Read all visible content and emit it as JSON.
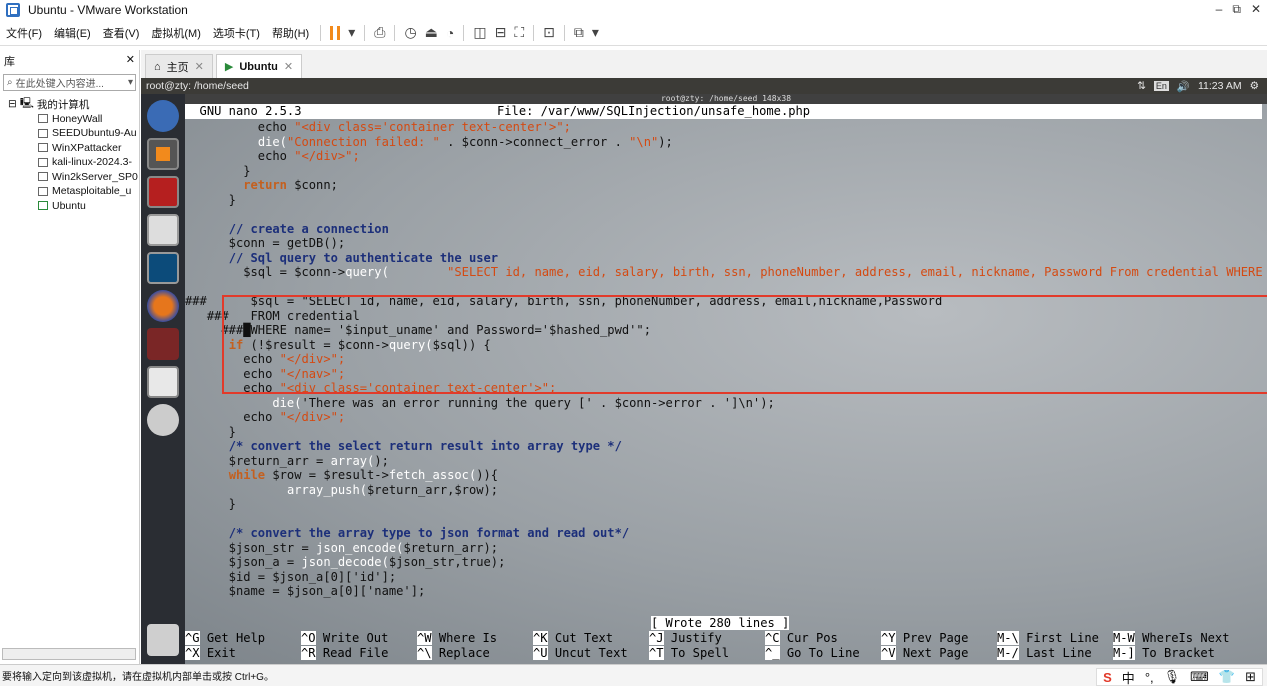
{
  "window": {
    "title": "Ubuntu - VMware Workstation",
    "controls": [
      "–",
      "⧉",
      "✕"
    ]
  },
  "menu": [
    "文件(F)",
    "编辑(E)",
    "查看(V)",
    "虚拟机(M)",
    "选项卡(T)",
    "帮助(H)"
  ],
  "library": {
    "title": "库",
    "close": "✕",
    "search_placeholder": "在此处键入内容进...",
    "root": "我的计算机",
    "vms": [
      "HoneyWall",
      "SEEDUbuntu9-Au",
      "WinXPattacker",
      "kali-linux-2024.3-",
      "Win2kServer_SP0",
      "Metasploitable_u",
      "Ubuntu"
    ]
  },
  "tabs": [
    {
      "label": "主页"
    },
    {
      "label": "Ubuntu"
    }
  ],
  "ubuntu": {
    "topbar_title": "root@zty: /home/seed",
    "clock": "11:23 AM",
    "lang": "En",
    "term_title": "root@zty: /home/seed 148x38"
  },
  "nano": {
    "version": "  GNU nano 2.5.3",
    "file": "File: /var/www/SQLInjection/unsafe_home.php",
    "status": "[ Wrote 280 lines ]"
  },
  "code": [
    [
      {
        "t": "          echo ",
        "c": "vr"
      },
      {
        "t": "\"<div class='container text-center'>\";",
        "c": "st"
      }
    ],
    [
      {
        "t": "          ",
        "c": "vr"
      },
      {
        "t": "die(",
        "c": "sc"
      },
      {
        "t": "\"Connection failed: \"",
        "c": "st"
      },
      {
        "t": " . $conn->connect_error . ",
        "c": "vr"
      },
      {
        "t": "\"\\n\"",
        "c": "st"
      },
      {
        "t": ");",
        "c": "vr"
      }
    ],
    [
      {
        "t": "          echo ",
        "c": "vr"
      },
      {
        "t": "\"</div>\";",
        "c": "st"
      }
    ],
    [
      {
        "t": "        }",
        "c": "vr"
      }
    ],
    [
      {
        "t": "        ",
        "c": "vr"
      },
      {
        "t": "return",
        "c": "kw"
      },
      {
        "t": " $conn;",
        "c": "vr"
      }
    ],
    [
      {
        "t": "      }",
        "c": "vr"
      }
    ],
    [
      {
        "t": "",
        "c": "vr"
      }
    ],
    [
      {
        "t": "      ",
        "c": "vr"
      },
      {
        "t": "// create a connection",
        "c": "cm"
      }
    ],
    [
      {
        "t": "      $conn = getDB();",
        "c": "vr"
      }
    ],
    [
      {
        "t": "      ",
        "c": "vr"
      },
      {
        "t": "// Sql query to authenticate the user",
        "c": "cm"
      }
    ],
    [
      {
        "t": "        $sql = $conn->",
        "c": "vr"
      },
      {
        "t": "query(",
        "c": "sc"
      },
      {
        "t": "        \"SELECT id, name, eid, salary, birth, ssn, phoneNumber, address, email, nickname, Password From credential WHERE name$",
        "c": "st"
      }
    ],
    [
      {
        "t": "",
        "c": "vr"
      }
    ],
    [
      {
        "t": "###      $sql = \"SELECT id, name, eid, salary, birth, ssn, phoneNumber, address, email,nickname,Password",
        "c": "vr"
      }
    ],
    [
      {
        "t": "   ###   FROM credential",
        "c": "vr"
      }
    ],
    [
      {
        "t": "     ###█WHERE name= '$input_uname' and Password='$hashed_pwd'\";",
        "c": "vr"
      }
    ],
    [
      {
        "t": "      ",
        "c": "vr"
      },
      {
        "t": "if",
        "c": "kw"
      },
      {
        "t": " (!$result = $conn->",
        "c": "vr"
      },
      {
        "t": "query(",
        "c": "sc"
      },
      {
        "t": "$sql)) {",
        "c": "vr"
      }
    ],
    [
      {
        "t": "        echo ",
        "c": "vr"
      },
      {
        "t": "\"</div>\";",
        "c": "st"
      }
    ],
    [
      {
        "t": "        echo ",
        "c": "vr"
      },
      {
        "t": "\"</nav>\";",
        "c": "st"
      }
    ],
    [
      {
        "t": "        echo ",
        "c": "vr"
      },
      {
        "t": "\"<div class='container text-center'>\";",
        "c": "st"
      }
    ],
    [
      {
        "t": "            ",
        "c": "vr"
      },
      {
        "t": "die(",
        "c": "sc"
      },
      {
        "t": "'There was an error running the query [' . $conn->error . ']\\n');",
        "c": "vr"
      }
    ],
    [
      {
        "t": "        echo ",
        "c": "vr"
      },
      {
        "t": "\"</div>\";",
        "c": "st"
      }
    ],
    [
      {
        "t": "      }",
        "c": "vr"
      }
    ],
    [
      {
        "t": "      ",
        "c": "vr"
      },
      {
        "t": "/* convert the select return result into array type */",
        "c": "cm"
      }
    ],
    [
      {
        "t": "      $return_arr = ",
        "c": "vr"
      },
      {
        "t": "array(",
        "c": "sc"
      },
      {
        "t": ");",
        "c": "vr"
      }
    ],
    [
      {
        "t": "      ",
        "c": "vr"
      },
      {
        "t": "while",
        "c": "kw"
      },
      {
        "t": " $row = $result->",
        "c": "vr"
      },
      {
        "t": "fetch_assoc(",
        "c": "sc"
      },
      {
        "t": ")){",
        "c": "vr"
      }
    ],
    [
      {
        "t": "              ",
        "c": "vr"
      },
      {
        "t": "array_push(",
        "c": "sc"
      },
      {
        "t": "$return_arr,$row);",
        "c": "vr"
      }
    ],
    [
      {
        "t": "      }",
        "c": "vr"
      }
    ],
    [
      {
        "t": "",
        "c": "vr"
      }
    ],
    [
      {
        "t": "      ",
        "c": "vr"
      },
      {
        "t": "/* convert the array type to json format and read out*/",
        "c": "cm"
      }
    ],
    [
      {
        "t": "      $json_str = ",
        "c": "vr"
      },
      {
        "t": "json_encode(",
        "c": "sc"
      },
      {
        "t": "$return_arr);",
        "c": "vr"
      }
    ],
    [
      {
        "t": "      $json_a = ",
        "c": "vr"
      },
      {
        "t": "json_decode(",
        "c": "sc"
      },
      {
        "t": "$json_str,true);",
        "c": "vr"
      }
    ],
    [
      {
        "t": "      $id = $json_a[0]['id'];",
        "c": "vr"
      }
    ],
    [
      {
        "t": "      $name = $json_a[0]['name'];",
        "c": "vr"
      }
    ]
  ],
  "help": [
    [
      {
        "k": "^G",
        "l": " Get Help"
      },
      {
        "k": "^O",
        "l": " Write Out"
      },
      {
        "k": "^W",
        "l": " Where Is"
      },
      {
        "k": "^K",
        "l": " Cut Text"
      },
      {
        "k": "^J",
        "l": " Justify"
      },
      {
        "k": "^C",
        "l": " Cur Pos"
      },
      {
        "k": "^Y",
        "l": " Prev Page"
      },
      {
        "k": "M-\\",
        "l": " First Line"
      },
      {
        "k": "M-W",
        "l": " WhereIs Next"
      }
    ],
    [
      {
        "k": "^X",
        "l": " Exit"
      },
      {
        "k": "^R",
        "l": " Read File"
      },
      {
        "k": "^\\",
        "l": " Replace"
      },
      {
        "k": "^U",
        "l": " Uncut Text"
      },
      {
        "k": "^T",
        "l": " To Spell"
      },
      {
        "k": "^_",
        "l": " Go To Line"
      },
      {
        "k": "^V",
        "l": " Next Page"
      },
      {
        "k": "M-/",
        "l": " Last Line"
      },
      {
        "k": "M-]",
        "l": " To Bracket"
      }
    ]
  ],
  "statusbar": {
    "text": "要将输入定向到该虚拟机，请在虚拟机内部单击或按 Ctrl+G。",
    "ime_label": "中"
  }
}
